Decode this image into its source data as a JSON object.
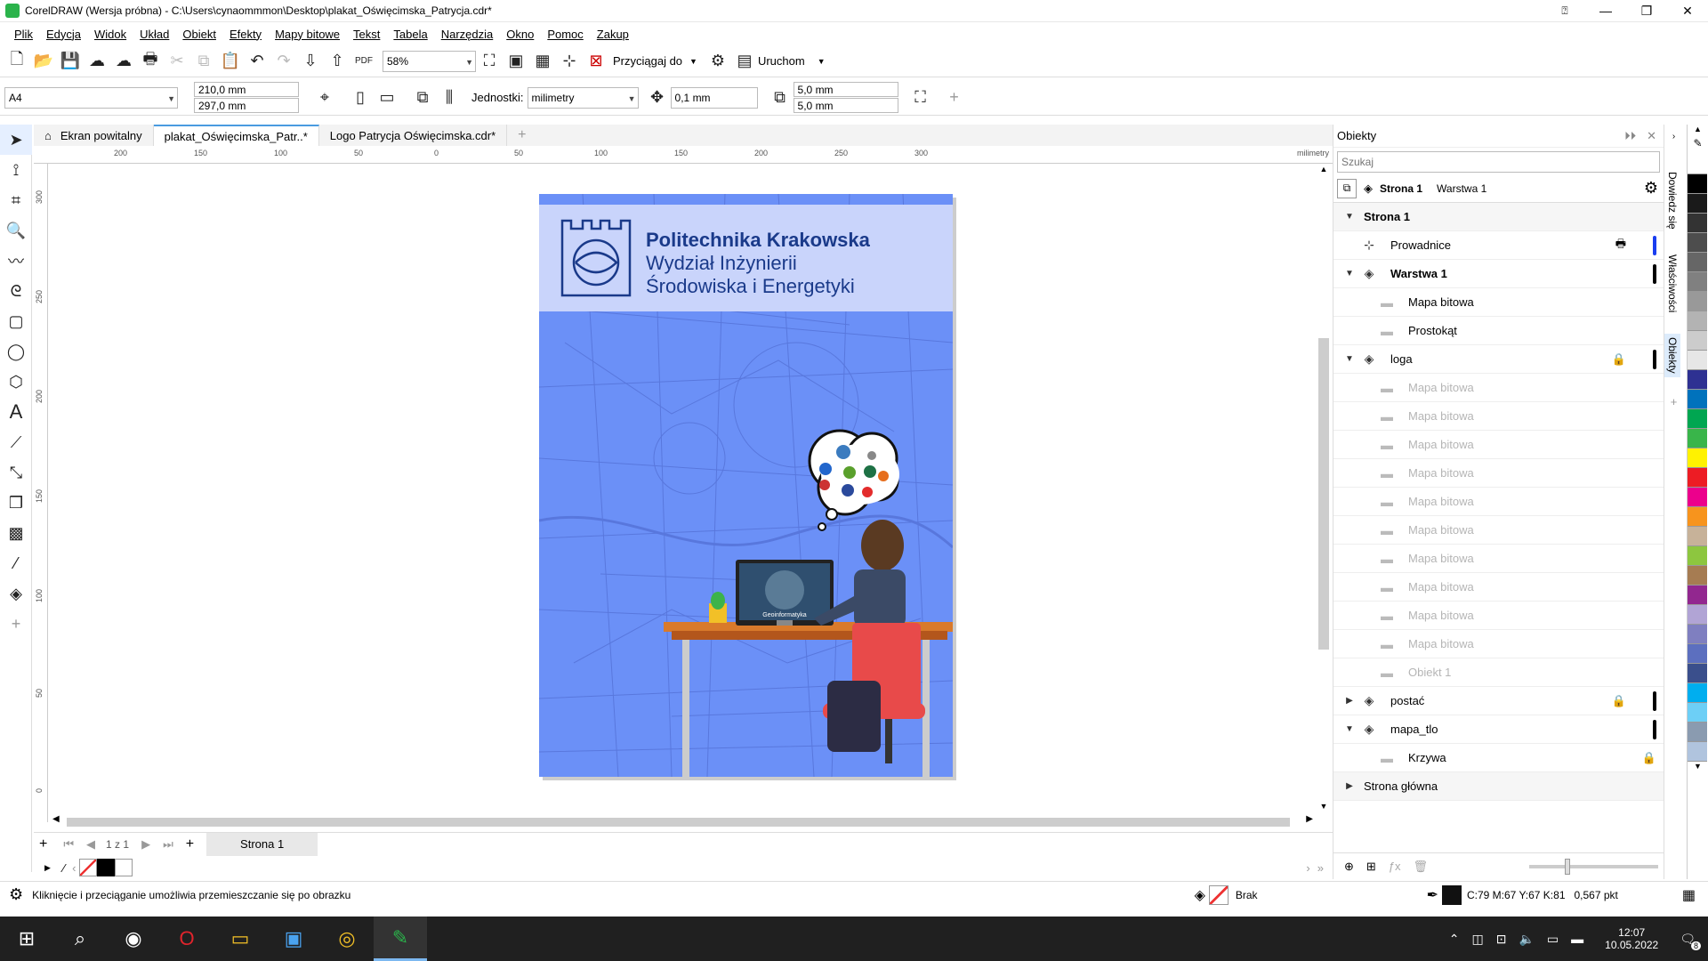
{
  "window": {
    "title": "CorelDRAW (Wersja próbna) - C:\\Users\\cynaommmon\\Desktop\\plakat_Oświęcimska_Patrycja.cdr*"
  },
  "menu": [
    "Plik",
    "Edycja",
    "Widok",
    "Układ",
    "Obiekt",
    "Efekty",
    "Mapy bitowe",
    "Tekst",
    "Tabela",
    "Narzędzia",
    "Okno",
    "Pomoc",
    "Zakup"
  ],
  "toolbar": {
    "zoom": "58%",
    "snap_label": "Przyciągaj do",
    "launch_label": "Uruchom"
  },
  "propbar": {
    "page_size": "A4",
    "width": "210,0 mm",
    "height": "297,0 mm",
    "units_label": "Jednostki:",
    "units_value": "milimetry",
    "nudge": "0,1 mm",
    "dup_x": "5,0 mm",
    "dup_y": "5,0 mm"
  },
  "tabs": [
    {
      "label": "Ekran powitalny"
    },
    {
      "label": "plakat_Oświęcimska_Patr..*"
    },
    {
      "label": "Logo Patrycja Oświęcimska.cdr*"
    }
  ],
  "ruler": {
    "unit": "milimetry",
    "h_ticks": [
      "200",
      "150",
      "100",
      "50",
      "0",
      "50",
      "100",
      "150",
      "200",
      "250",
      "300"
    ],
    "v_ticks": [
      "300",
      "250",
      "200",
      "150",
      "100",
      "50",
      "0"
    ]
  },
  "poster": {
    "title_line1": "Politechnika Krakowska",
    "title_line2": "Wydział Inżynierii",
    "title_line3": "Środowiska i Energetyki",
    "monitor_label": "Geoinformatyka",
    "bg_color": "#6b90f7",
    "header_color": "#c9d4fb",
    "text_color": "#1a3a8a"
  },
  "pagebar": {
    "page_counter": "1 z 1",
    "page_tab": "Strona 1"
  },
  "status": {
    "hint": "Kliknięcie i przeciąganie umożliwia przemieszczanie się po obrazku",
    "fill_label": "Brak",
    "color_info": "C:79 M:67 Y:67 K:81",
    "outline": "0,567 pkt"
  },
  "objects_panel": {
    "title": "Obiekty",
    "search_placeholder": "Szukaj",
    "crumb_page": "Strona 1",
    "crumb_layer": "Warstwa 1",
    "tree": [
      {
        "label": "Strona 1",
        "level": 0,
        "bold": true,
        "tri": "▼"
      },
      {
        "label": "Prowadnice",
        "level": 1,
        "icon": "guides-icon",
        "lock": "printer-icon",
        "bar": "#1a3ef0"
      },
      {
        "label": "Warstwa 1",
        "level": 1,
        "bold": true,
        "tri": "▼",
        "icon": "layer-icon",
        "bar": "#000000"
      },
      {
        "label": "Mapa bitowa",
        "level": 2
      },
      {
        "label": "Prostokąt",
        "level": 2
      },
      {
        "label": "loga",
        "level": 1,
        "tri": "▼",
        "icon": "layer-icon",
        "lock": "lock-icon",
        "bar": "#000000"
      },
      {
        "label": "Mapa bitowa",
        "level": 2,
        "grey": true
      },
      {
        "label": "Mapa bitowa",
        "level": 2,
        "grey": true
      },
      {
        "label": "Mapa bitowa",
        "level": 2,
        "grey": true
      },
      {
        "label": "Mapa bitowa",
        "level": 2,
        "grey": true
      },
      {
        "label": "Mapa bitowa",
        "level": 2,
        "grey": true
      },
      {
        "label": "Mapa bitowa",
        "level": 2,
        "grey": true
      },
      {
        "label": "Mapa bitowa",
        "level": 2,
        "grey": true
      },
      {
        "label": "Mapa bitowa",
        "level": 2,
        "grey": true
      },
      {
        "label": "Mapa bitowa",
        "level": 2,
        "grey": true
      },
      {
        "label": "Mapa bitowa",
        "level": 2,
        "grey": true
      },
      {
        "label": "Obiekt 1",
        "level": 2,
        "grey": true
      },
      {
        "label": "postać",
        "level": 1,
        "tri": "▶",
        "icon": "layer-icon",
        "lock": "lock-icon",
        "bar": "#000000"
      },
      {
        "label": "mapa_tlo",
        "level": 1,
        "tri": "▼",
        "icon": "layer-icon",
        "bar": "#000000"
      },
      {
        "label": "Krzywa",
        "level": 2,
        "lock": "lock-icon"
      },
      {
        "label": "Strona główna",
        "level": 0,
        "tri": "▶"
      }
    ]
  },
  "dock_tabs": [
    "Dowiedz się",
    "Właściwości",
    "Obiekty"
  ],
  "palette_colors": [
    "#ffffff",
    "#000000",
    "#1a1a1a",
    "#333333",
    "#4d4d4d",
    "#666666",
    "#808080",
    "#999999",
    "#b3b3b3",
    "#cccccc",
    "#e6e6e6",
    "#2e3192",
    "#0072bc",
    "#00a651",
    "#39b54a",
    "#fff200",
    "#ed1c24",
    "#ec008c",
    "#f7941d",
    "#c7b299",
    "#8dc63f",
    "#a67c52",
    "#92278f",
    "#b1a4d5",
    "#7f7fc0",
    "#5c6fbf",
    "#3a4f8c",
    "#00aeef",
    "#6dcff6",
    "#8a9bb0",
    "#b0c4de"
  ],
  "clock": {
    "time": "12:07",
    "date": "10.05.2022"
  },
  "taskbar": {
    "notif_count": "8"
  }
}
